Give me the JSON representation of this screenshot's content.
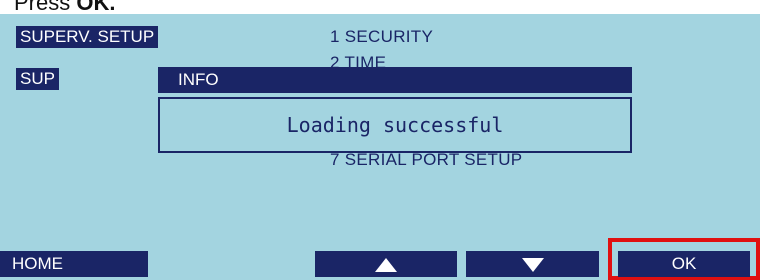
{
  "caption": {
    "prefix": "Press ",
    "emphasis": "OK."
  },
  "header": {
    "title_chip": "SUPERV. SETUP",
    "sub_chip": "SUP"
  },
  "menu": {
    "items": [
      "1  SECURITY",
      "2  TIME",
      "7  SERIAL PORT SETUP"
    ]
  },
  "dialog": {
    "title": "INFO",
    "message": "Loading successful"
  },
  "softkeys": {
    "home": "HOME",
    "up_icon": "up-arrow-icon",
    "down_icon": "down-arrow-icon",
    "ok": "OK"
  },
  "colors": {
    "screen_background": "#a3d4e0",
    "chip_navy": "#1a2566",
    "highlight_red": "#e01010"
  }
}
